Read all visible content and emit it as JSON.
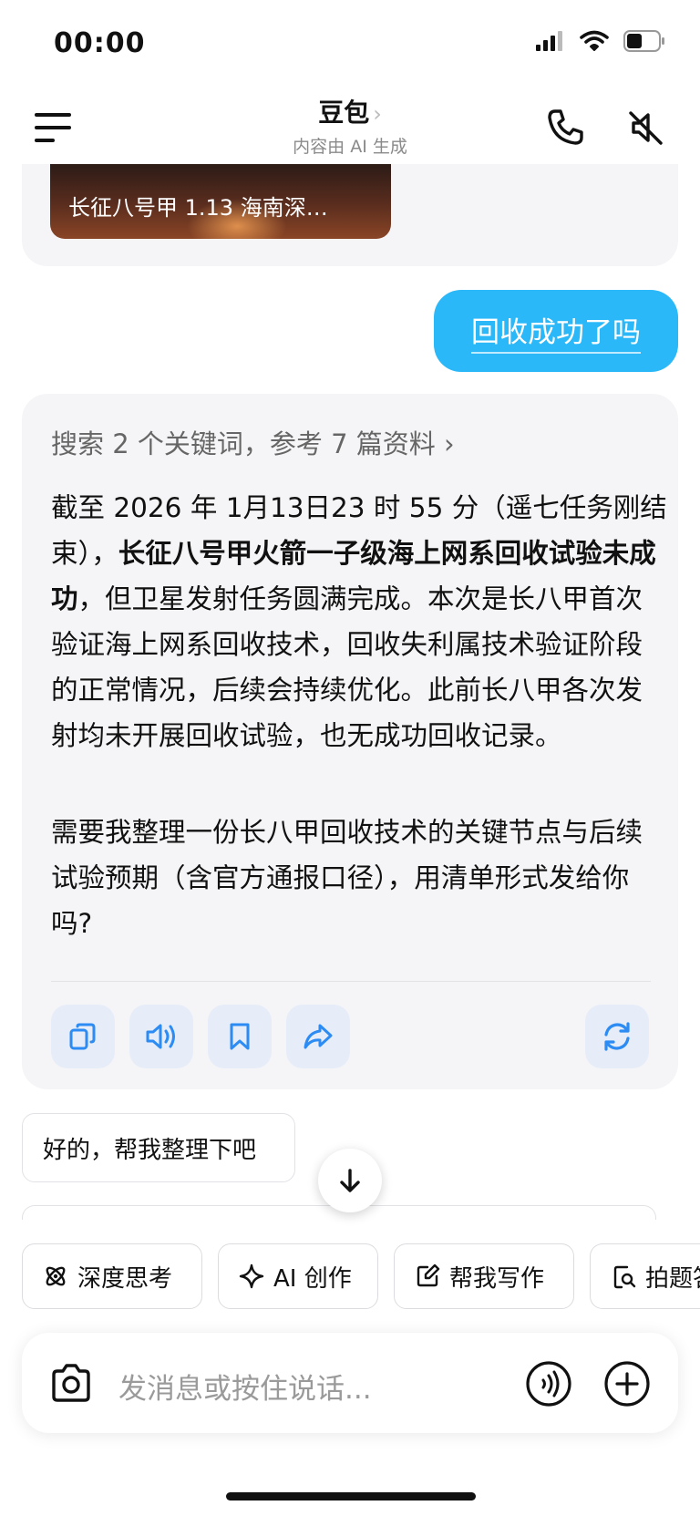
{
  "status_bar": {
    "time": "00:00",
    "icons": [
      "signal-icon",
      "wifi-icon",
      "battery-icon"
    ]
  },
  "header": {
    "title": "豆包",
    "subtitle": "内容由 AI 生成",
    "icons": [
      "menu-icon",
      "phone-icon",
      "mute-icon"
    ]
  },
  "prev_message": {
    "video_caption": "长征八号甲 1.13 海南深…"
  },
  "user_message": {
    "text": "回收成功了吗"
  },
  "answer": {
    "search_summary": "搜索 2 个关键词，参考 7 篇资料 ›",
    "p1_pre": "截至 2026 年 1月13日23 时 55 分（遥七任务刚结束），",
    "p1_bold": "长征八号甲火箭一子级海上网系回收试验未成功",
    "p1_post": "，但卫星发射任务圆满完成。本次是长八甲首次验证海上网系回收技术，回收失利属技术验证阶段的正常情况，后续会持续优化。此前长八甲各次发射均未开展回收试验，也无成功回收记录。",
    "p2": "需要我整理一份长八甲回收技术的关键节点与后续试验预期（含官方通报口径），用清单形式发给你吗?",
    "action_icons": [
      "copy-icon",
      "speaker-icon",
      "bookmark-icon",
      "share-icon",
      "regenerate-icon"
    ]
  },
  "suggestion": {
    "text": "好的，帮我整理下吧"
  },
  "tools": [
    {
      "label": "深度思考",
      "icon": "atom-icon"
    },
    {
      "label": "AI 创作",
      "icon": "sparkle-icon"
    },
    {
      "label": "帮我写作",
      "icon": "edit-icon"
    },
    {
      "label": "拍题答疑",
      "icon": "scan-doc-icon"
    }
  ],
  "input": {
    "placeholder": "发消息或按住说话...",
    "icons": [
      "camera-icon",
      "voice-icon",
      "plus-icon"
    ]
  },
  "colors": {
    "accent": "#2ab8f9",
    "card": "#f5f5f7",
    "action_btn": "#e6edf8",
    "icon_blue": "#2c8cf4"
  }
}
